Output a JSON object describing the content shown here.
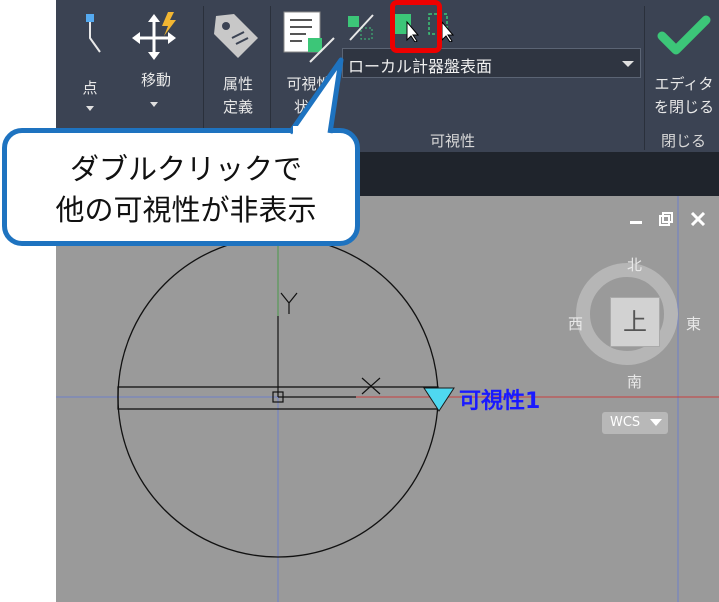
{
  "ribbon": {
    "point_label": "点",
    "move_label": "移動",
    "attr_label_line1": "属性",
    "attr_label_line2": "定義",
    "vis_state_line1": "可視性",
    "vis_state_line2": "状態",
    "visibility_combo": "ローカル計器盤表面",
    "visibility_panel_title": "可視性",
    "close_editor_line1": "エディタ",
    "close_editor_line2": "を閉じる",
    "close_panel_title": "閉じる"
  },
  "callout": {
    "line1": "ダブルクリックで",
    "line2": "他の可視性が非表示"
  },
  "viewport": {
    "visibility_param_label": "可視性1",
    "y_axis_label": "Y",
    "viewcube": {
      "north": "北",
      "south": "南",
      "east": "東",
      "west": "西",
      "top": "上"
    },
    "wcs_label": "WCS"
  },
  "colors": {
    "ribbon_bg": "#3b4353",
    "viewport_bg": "#9a9a9a",
    "callout_border": "#1e73c0",
    "highlight": "#ee0000",
    "vis_label": "#1a1aff",
    "check_green": "#3cc678"
  }
}
